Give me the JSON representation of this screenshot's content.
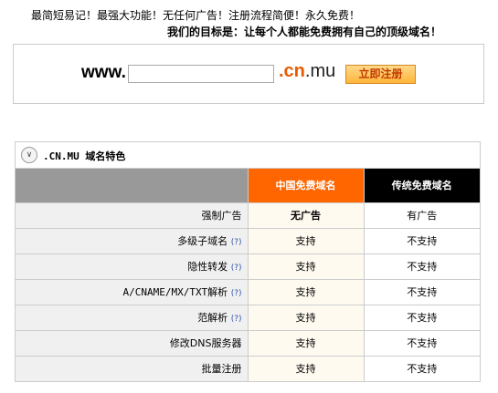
{
  "slogans": {
    "line1": "最简短易记！最强大功能！无任何广告！注册流程简便！永久免费！",
    "line2": "我们的目标是：让每个人都能免费拥有自己的顶级域名！"
  },
  "register": {
    "prefix": "www.",
    "input_value": "",
    "suffix_cn": ".cn",
    "suffix_rest": ".mu",
    "button_label": "立即注册"
  },
  "features": {
    "collapse_icon": "chevron-down-icon",
    "title": ".CN.MU 域名特色",
    "columns": [
      "",
      "中国免费域名",
      "传统免费域名"
    ],
    "rows": [
      {
        "label": "强制广告",
        "help": "",
        "cn": "无广告",
        "trad": "有广告"
      },
      {
        "label": "多级子域名",
        "help": "(?)",
        "cn": "支持",
        "trad": "不支持"
      },
      {
        "label": "隐性转发",
        "help": "(?)",
        "cn": "支持",
        "trad": "不支持"
      },
      {
        "label": "A/CNAME/MX/TXT解析",
        "help": "(?)",
        "cn": "支持",
        "trad": "不支持"
      },
      {
        "label": "范解析",
        "help": "(?)",
        "cn": "支持",
        "trad": "不支持"
      },
      {
        "label": "修改DNS服务器",
        "help": "",
        "cn": "支持",
        "trad": "不支持"
      },
      {
        "label": "批量注册",
        "help": "",
        "cn": "支持",
        "trad": "不支持"
      }
    ]
  },
  "colors": {
    "accent_orange": "#ff6600",
    "header_black": "#000000",
    "header_gray": "#999999"
  }
}
